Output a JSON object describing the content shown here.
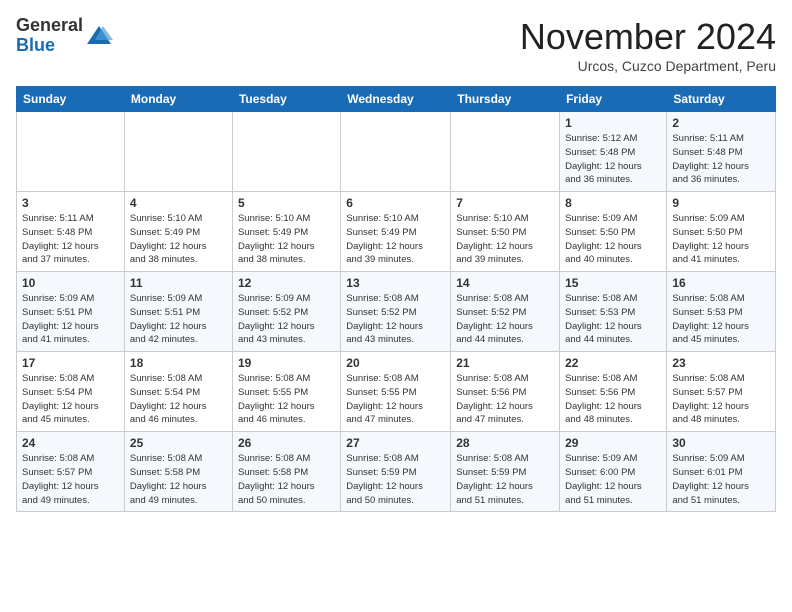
{
  "header": {
    "logo": {
      "general": "General",
      "blue": "Blue"
    },
    "title": "November 2024",
    "location": "Urcos, Cuzco Department, Peru"
  },
  "days_of_week": [
    "Sunday",
    "Monday",
    "Tuesday",
    "Wednesday",
    "Thursday",
    "Friday",
    "Saturday"
  ],
  "weeks": [
    [
      {
        "num": "",
        "info": ""
      },
      {
        "num": "",
        "info": ""
      },
      {
        "num": "",
        "info": ""
      },
      {
        "num": "",
        "info": ""
      },
      {
        "num": "",
        "info": ""
      },
      {
        "num": "1",
        "info": "Sunrise: 5:12 AM\nSunset: 5:48 PM\nDaylight: 12 hours\nand 36 minutes."
      },
      {
        "num": "2",
        "info": "Sunrise: 5:11 AM\nSunset: 5:48 PM\nDaylight: 12 hours\nand 36 minutes."
      }
    ],
    [
      {
        "num": "3",
        "info": "Sunrise: 5:11 AM\nSunset: 5:48 PM\nDaylight: 12 hours\nand 37 minutes."
      },
      {
        "num": "4",
        "info": "Sunrise: 5:10 AM\nSunset: 5:49 PM\nDaylight: 12 hours\nand 38 minutes."
      },
      {
        "num": "5",
        "info": "Sunrise: 5:10 AM\nSunset: 5:49 PM\nDaylight: 12 hours\nand 38 minutes."
      },
      {
        "num": "6",
        "info": "Sunrise: 5:10 AM\nSunset: 5:49 PM\nDaylight: 12 hours\nand 39 minutes."
      },
      {
        "num": "7",
        "info": "Sunrise: 5:10 AM\nSunset: 5:50 PM\nDaylight: 12 hours\nand 39 minutes."
      },
      {
        "num": "8",
        "info": "Sunrise: 5:09 AM\nSunset: 5:50 PM\nDaylight: 12 hours\nand 40 minutes."
      },
      {
        "num": "9",
        "info": "Sunrise: 5:09 AM\nSunset: 5:50 PM\nDaylight: 12 hours\nand 41 minutes."
      }
    ],
    [
      {
        "num": "10",
        "info": "Sunrise: 5:09 AM\nSunset: 5:51 PM\nDaylight: 12 hours\nand 41 minutes."
      },
      {
        "num": "11",
        "info": "Sunrise: 5:09 AM\nSunset: 5:51 PM\nDaylight: 12 hours\nand 42 minutes."
      },
      {
        "num": "12",
        "info": "Sunrise: 5:09 AM\nSunset: 5:52 PM\nDaylight: 12 hours\nand 43 minutes."
      },
      {
        "num": "13",
        "info": "Sunrise: 5:08 AM\nSunset: 5:52 PM\nDaylight: 12 hours\nand 43 minutes."
      },
      {
        "num": "14",
        "info": "Sunrise: 5:08 AM\nSunset: 5:52 PM\nDaylight: 12 hours\nand 44 minutes."
      },
      {
        "num": "15",
        "info": "Sunrise: 5:08 AM\nSunset: 5:53 PM\nDaylight: 12 hours\nand 44 minutes."
      },
      {
        "num": "16",
        "info": "Sunrise: 5:08 AM\nSunset: 5:53 PM\nDaylight: 12 hours\nand 45 minutes."
      }
    ],
    [
      {
        "num": "17",
        "info": "Sunrise: 5:08 AM\nSunset: 5:54 PM\nDaylight: 12 hours\nand 45 minutes."
      },
      {
        "num": "18",
        "info": "Sunrise: 5:08 AM\nSunset: 5:54 PM\nDaylight: 12 hours\nand 46 minutes."
      },
      {
        "num": "19",
        "info": "Sunrise: 5:08 AM\nSunset: 5:55 PM\nDaylight: 12 hours\nand 46 minutes."
      },
      {
        "num": "20",
        "info": "Sunrise: 5:08 AM\nSunset: 5:55 PM\nDaylight: 12 hours\nand 47 minutes."
      },
      {
        "num": "21",
        "info": "Sunrise: 5:08 AM\nSunset: 5:56 PM\nDaylight: 12 hours\nand 47 minutes."
      },
      {
        "num": "22",
        "info": "Sunrise: 5:08 AM\nSunset: 5:56 PM\nDaylight: 12 hours\nand 48 minutes."
      },
      {
        "num": "23",
        "info": "Sunrise: 5:08 AM\nSunset: 5:57 PM\nDaylight: 12 hours\nand 48 minutes."
      }
    ],
    [
      {
        "num": "24",
        "info": "Sunrise: 5:08 AM\nSunset: 5:57 PM\nDaylight: 12 hours\nand 49 minutes."
      },
      {
        "num": "25",
        "info": "Sunrise: 5:08 AM\nSunset: 5:58 PM\nDaylight: 12 hours\nand 49 minutes."
      },
      {
        "num": "26",
        "info": "Sunrise: 5:08 AM\nSunset: 5:58 PM\nDaylight: 12 hours\nand 50 minutes."
      },
      {
        "num": "27",
        "info": "Sunrise: 5:08 AM\nSunset: 5:59 PM\nDaylight: 12 hours\nand 50 minutes."
      },
      {
        "num": "28",
        "info": "Sunrise: 5:08 AM\nSunset: 5:59 PM\nDaylight: 12 hours\nand 51 minutes."
      },
      {
        "num": "29",
        "info": "Sunrise: 5:09 AM\nSunset: 6:00 PM\nDaylight: 12 hours\nand 51 minutes."
      },
      {
        "num": "30",
        "info": "Sunrise: 5:09 AM\nSunset: 6:01 PM\nDaylight: 12 hours\nand 51 minutes."
      }
    ]
  ]
}
